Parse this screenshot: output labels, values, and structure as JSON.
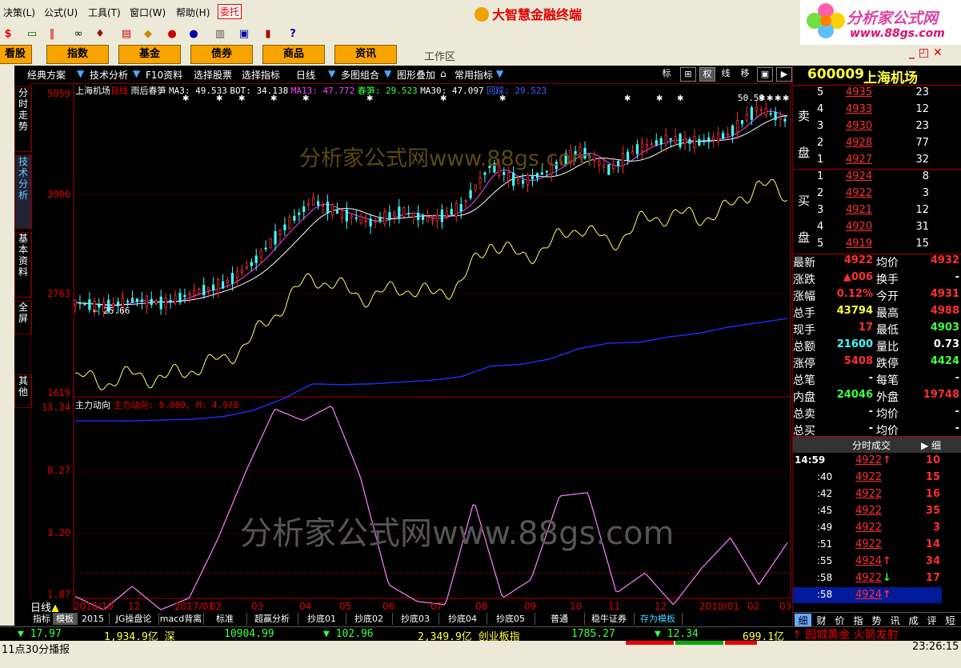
{
  "menu": {
    "items": [
      "决策(L)",
      "公式(U)",
      "工具(T)",
      "窗口(W)",
      "帮助(H)"
    ],
    "entrust": "委托",
    "app_title": "大智慧金融终端"
  },
  "brand": {
    "name": "分析家公式网",
    "url": "www.88gs.com"
  },
  "tabs": [
    "看股",
    "指数",
    "基金",
    "债券",
    "商品",
    "资讯"
  ],
  "workspace_label": "工作区",
  "chart_toolbar": {
    "items": [
      "经典方案",
      "技术分析",
      "F10资料",
      "选择股票",
      "选择指标",
      "日线",
      "多图组合",
      "图形叠加",
      "常用指标"
    ],
    "right_buttons": [
      "标",
      "⊞",
      "权",
      "线",
      "移",
      "▣",
      "▶"
    ]
  },
  "side_tabs": [
    "分时走势",
    "技术分析",
    "基本资料",
    "全屏",
    "其他"
  ],
  "watermark": "分析家公式网www.88gs.com",
  "price_chart": {
    "stock": "上海机场",
    "period": "日线",
    "note": "雨后春笋",
    "legend": [
      {
        "text": "MA3: 49.533",
        "color": "#ffffff"
      },
      {
        "text": "BOT: 34.138",
        "color": "#ffffff"
      },
      {
        "text": "MA13: 47.772",
        "color": "#ff40ff"
      },
      {
        "text": "春笋: 29.523",
        "color": "#40ff40"
      },
      {
        "text": "MA30: 47.097",
        "color": "#ffffff"
      },
      {
        "text": "回踩: 29.523",
        "color": "#4060ff"
      }
    ],
    "y_labels": [
      "5059",
      "3906",
      "2763",
      "1619"
    ],
    "high_label": "50.59",
    "low_label": "25.66"
  },
  "indicator": {
    "name": "主力动向",
    "legend": "主力动向: 0.000, M: 4.978",
    "y_labels": [
      "13.34",
      "8.27",
      "3.20",
      "1.87"
    ]
  },
  "x_labels": [
    "2016/10",
    "12",
    "2017/01",
    "02",
    "03",
    "04",
    "05",
    "06",
    "07",
    "08",
    "09",
    "10",
    "11",
    "12",
    "2018/01",
    "02",
    "03"
  ],
  "period_footer": "日线",
  "chart_data": {
    "type": "line",
    "title": "上海机场 日线",
    "series": [
      {
        "name": "上海机场",
        "values": [
          26.5,
          26.0,
          26.8,
          26.4,
          27.6,
          28.5,
          31.0,
          34.8,
          38.0,
          36.5,
          35.5,
          36.8,
          35.8,
          37.2,
          42.0,
          40.0,
          41.5,
          43.8,
          41.5,
          44.0,
          45.0,
          44.6,
          45.5,
          48.5,
          47.0
        ]
      },
      {
        "name": "回踩",
        "values": [
          13.1,
          13.1,
          13.1,
          13.2,
          13.3,
          13.6,
          14.3,
          15.6,
          17.3,
          17.2,
          17.3,
          17.5,
          17.7,
          18.1,
          19.3,
          19.5,
          20.1,
          21.3,
          21.9,
          22.0,
          22.6,
          23.0,
          23.7,
          24.2,
          24.7
        ]
      },
      {
        "name": "主力动向",
        "values": [
          1.8,
          1.0,
          2.4,
          1.0,
          1.7,
          5.2,
          9.3,
          13.0,
          12.3,
          13.2,
          9.0,
          2.5,
          1.5,
          1.3,
          7.5,
          1.7,
          2.8,
          7.8,
          8.0,
          2.0,
          3.2,
          1.3,
          3.5,
          5.3,
          2.5,
          5.0
        ]
      }
    ],
    "ylim": [
      16.19,
      50.59
    ],
    "indicator_ylim": [
      1.87,
      13.34
    ]
  },
  "right_panel": {
    "code": "600009",
    "name": "上海机场",
    "sell_label": "卖盘",
    "buy_label": "买盘",
    "sell": [
      {
        "lvl": "5",
        "price": "4935",
        "vol": "23"
      },
      {
        "lvl": "4",
        "price": "4933",
        "vol": "12"
      },
      {
        "lvl": "3",
        "price": "4930",
        "vol": "23"
      },
      {
        "lvl": "2",
        "price": "4928",
        "vol": "77"
      },
      {
        "lvl": "1",
        "price": "4927",
        "vol": "32"
      }
    ],
    "buy": [
      {
        "lvl": "1",
        "price": "4924",
        "vol": "8"
      },
      {
        "lvl": "2",
        "price": "4922",
        "vol": "3"
      },
      {
        "lvl": "3",
        "price": "4921",
        "vol": "12"
      },
      {
        "lvl": "4",
        "price": "4920",
        "vol": "31"
      },
      {
        "lvl": "5",
        "price": "4919",
        "vol": "15"
      }
    ],
    "stats": [
      {
        "k1": "最新",
        "v1": "4922",
        "c1": "#ff3030",
        "k2": "均价",
        "v2": "4932",
        "c2": "#ff3030"
      },
      {
        "k1": "涨跌",
        "v1": "▲006",
        "c1": "#ff3030",
        "k2": "换手",
        "v2": "-",
        "c2": "#ffffff"
      },
      {
        "k1": "涨幅",
        "v1": "0.12%",
        "c1": "#ff3030",
        "k2": "今开",
        "v2": "4931",
        "c2": "#ff3030"
      },
      {
        "k1": "总手",
        "v1": "43794",
        "c1": "#ffff40",
        "k2": "最高",
        "v2": "4988",
        "c2": "#ff3030"
      },
      {
        "k1": "现手",
        "v1": "17",
        "c1": "#ff3030",
        "k2": "最低",
        "v2": "4903",
        "c2": "#40ff40"
      },
      {
        "k1": "总额",
        "v1": "21600",
        "c1": "#40ffff",
        "k2": "量比",
        "v2": "0.73",
        "c2": "#ffffff"
      },
      {
        "k1": "涨停",
        "v1": "5408",
        "c1": "#ff3030",
        "k2": "跌停",
        "v2": "4424",
        "c2": "#40ff40"
      },
      {
        "k1": "总笔",
        "v1": "-",
        "c1": "#ffffff",
        "k2": "每笔",
        "v2": "-",
        "c2": "#ffffff"
      },
      {
        "k1": "内盘",
        "v1": "24046",
        "c1": "#40ff40",
        "k2": "外盘",
        "v2": "19748",
        "c2": "#ff3030"
      },
      {
        "k1": "总卖",
        "v1": "-",
        "c1": "#ffffff",
        "k2": "均价",
        "v2": "-",
        "c2": "#ffffff"
      },
      {
        "k1": "总买",
        "v1": "-",
        "c1": "#ffffff",
        "k2": "均价",
        "v2": "-",
        "c2": "#ffffff"
      }
    ],
    "ticks_header": "分时成交",
    "ticks_detail": "细",
    "ticks": [
      {
        "time": "14:59",
        "price": "4922",
        "dir": "↑",
        "vol": "10"
      },
      {
        "time": ":40",
        "price": "4922",
        "dir": "",
        "vol": "15"
      },
      {
        "time": ":42",
        "price": "4922",
        "dir": "",
        "vol": "16"
      },
      {
        "time": ":45",
        "price": "4922",
        "dir": "",
        "vol": "35"
      },
      {
        "time": ":49",
        "price": "4922",
        "dir": "",
        "vol": "3"
      },
      {
        "time": ":51",
        "price": "4922",
        "dir": "",
        "vol": "14"
      },
      {
        "time": ":55",
        "price": "4924",
        "dir": "↑",
        "vol": "34"
      },
      {
        "time": ":58",
        "price": "4922",
        "dir": "↓",
        "vol": "17"
      },
      {
        "time": ":58",
        "price": "4924",
        "dir": "↑",
        "vol": ""
      }
    ],
    "bottom_tabs": [
      "细",
      "财",
      "价",
      "指",
      "势",
      "讯",
      "成",
      "评",
      "短"
    ]
  },
  "bottom_tabs": [
    "指标",
    "模板",
    "2015",
    "JG操盘论",
    "macd背离",
    "标准",
    "超赢分析",
    "抄底01",
    "抄底02",
    "抄底03",
    "抄底04",
    "抄底05",
    "普通",
    "稳牛证券",
    "存为模板"
  ],
  "status": {
    "items": [
      {
        "text": "▼ 17.97",
        "color": "#40ff40"
      },
      {
        "text": "1,934.9亿 深",
        "color": "#ffff40"
      },
      {
        "text": "10904.99",
        "color": "#40ff40"
      },
      {
        "text": "▼ 102.96",
        "color": "#40ff40"
      },
      {
        "text": "2,349.9亿 创业板指",
        "color": "#ffff40"
      },
      {
        "text": "1785.27",
        "color": "#40ff40"
      },
      {
        "text": "▼ 12.34",
        "color": "#40ff40"
      },
      {
        "text": "699.1亿",
        "color": "#ffff40"
      }
    ],
    "ticker_left": "11点30分播报",
    "news": "园城黄金 火箭发射",
    "time": "23:26:15"
  }
}
